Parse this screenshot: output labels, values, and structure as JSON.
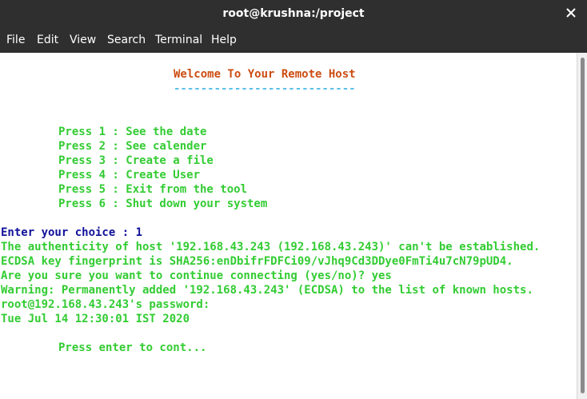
{
  "window": {
    "title": "root@krushna:/project"
  },
  "menubar": {
    "items": [
      "File",
      "Edit",
      "View",
      "Search",
      "Terminal",
      "Help"
    ]
  },
  "terminal": {
    "banner": "Welcome To Your Remote Host",
    "banner_underline": "---------------------------",
    "menu_lines": [
      "Press 1 : See the date",
      "Press 2 : See calender",
      "Press 3 : Create a file",
      "Press 4 : Create User",
      "Press 5 : Exit from the tool",
      "Press 6 : Shut down your system"
    ],
    "prompt": "Enter your choice : ",
    "choice": "1",
    "output_lines": [
      "The authenticity of host '192.168.43.243 (192.168.43.243)' can't be established.",
      "ECDSA key fingerprint is SHA256:enDbifrFDFCi09/vJhq9Cd3DDye0FmTi4u7cN79pUD4.",
      "Are you sure you want to continue connecting (yes/no)? yes",
      "Warning: Permanently added '192.168.43.243' (ECDSA) to the list of known hosts.",
      "root@192.168.43.243's password:",
      "Tue Jul 14 12:30:01 IST 2020"
    ],
    "continue_prompt": "Press enter to cont..."
  },
  "colors": {
    "text_green": "#33cc33",
    "prompt_blue": "#111199",
    "banner_orange": "#cc4d12",
    "underline_cyan": "#5cc0e8",
    "titlebar_bg": "#2f2f2f"
  },
  "icons": {
    "close": "close-icon"
  }
}
